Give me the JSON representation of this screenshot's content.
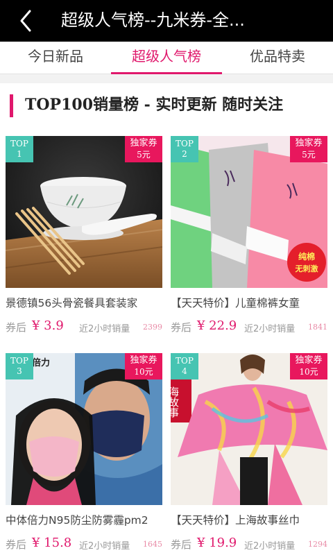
{
  "header": {
    "title": "超级人气榜--九米券-全..."
  },
  "tabs": [
    {
      "label": "今日新品"
    },
    {
      "label": "超级人气榜"
    },
    {
      "label": "优品特卖"
    }
  ],
  "section": {
    "title": "TOP100销量榜 - 实时更新 随时关注"
  },
  "labels": {
    "after_coupon": "券后",
    "sales_2h": "近2小时销量"
  },
  "colors": {
    "accent": "#e0186c",
    "rank_badge": "#46c4b2",
    "coupon_badge": "#e8175d",
    "topbar": "#000000"
  },
  "products": [
    {
      "rank_label": "TOP",
      "rank_num": "1",
      "coupon_label": "独家券",
      "coupon_amount": "5元",
      "name": "景德镇56头骨瓷餐具套装家",
      "price": "¥ 3.9",
      "sales": "2399",
      "image": "porcelain-tableware-photo"
    },
    {
      "rank_label": "TOP",
      "rank_num": "2",
      "coupon_label": "独家券",
      "coupon_amount": "5元",
      "name": "【天天特价】儿童棉裤女童",
      "price": "¥ 22.9",
      "sales": "1841",
      "image": "kids-fleece-pants-photo",
      "image_text": [
        "纯棉",
        "无刺激"
      ]
    },
    {
      "rank_label": "TOP",
      "rank_num": "3",
      "coupon_label": "独家券",
      "coupon_amount": "10元",
      "name": "中体倍力N95防尘防雾霾pm2",
      "price": "¥ 15.8",
      "sales": "1645",
      "image": "face-mask-couple-photo",
      "image_text": [
        "中体倍力"
      ]
    },
    {
      "rank_label": "TOP",
      "rank_num": "4",
      "coupon_label": "独家券",
      "coupon_amount": "10元",
      "name": "【天天特价】上海故事丝巾",
      "price": "¥ 19.9",
      "sales": "1294",
      "image": "silk-scarf-model-photo",
      "image_text": [
        "海故事"
      ]
    }
  ]
}
